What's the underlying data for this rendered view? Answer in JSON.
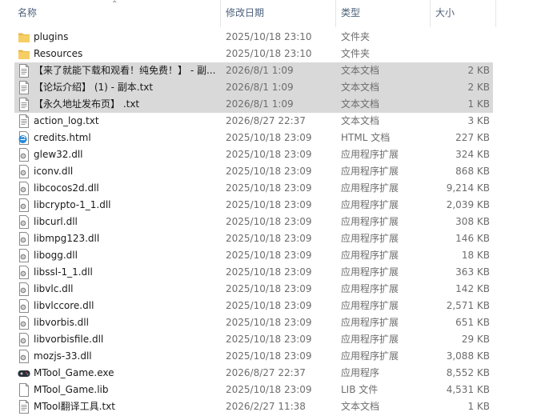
{
  "columns": {
    "name": "名称",
    "date": "修改日期",
    "type": "类型",
    "size": "大小"
  },
  "sort_indicator": "⌃",
  "files": [
    {
      "name": "plugins",
      "date": "2025/10/18 23:10",
      "type": "文件夹",
      "size": "",
      "icon": "folder-icon",
      "selected": false
    },
    {
      "name": "Resources",
      "date": "2025/10/18 23:10",
      "type": "文件夹",
      "size": "",
      "icon": "folder-icon",
      "selected": false
    },
    {
      "name": "【来了就能下载和观看！纯免费！】 - 副...",
      "date": "2026/8/1 1:09",
      "type": "文本文档",
      "size": "2 KB",
      "icon": "text-file-icon",
      "selected": true
    },
    {
      "name": "【论坛介绍】 (1) - 副本.txt",
      "date": "2026/8/1 1:09",
      "type": "文本文档",
      "size": "2 KB",
      "icon": "text-file-icon",
      "selected": true
    },
    {
      "name": "【永久地址发布页】 .txt",
      "date": "2026/8/1 1:09",
      "type": "文本文档",
      "size": "1 KB",
      "icon": "text-file-icon",
      "selected": true
    },
    {
      "name": "action_log.txt",
      "date": "2026/8/27 22:37",
      "type": "文本文档",
      "size": "3 KB",
      "icon": "text-file-icon",
      "selected": false
    },
    {
      "name": "credits.html",
      "date": "2025/10/18 23:09",
      "type": "HTML 文档",
      "size": "227 KB",
      "icon": "html-file-icon",
      "selected": false
    },
    {
      "name": "glew32.dll",
      "date": "2025/10/18 23:09",
      "type": "应用程序扩展",
      "size": "324 KB",
      "icon": "dll-file-icon",
      "selected": false
    },
    {
      "name": "iconv.dll",
      "date": "2025/10/18 23:09",
      "type": "应用程序扩展",
      "size": "868 KB",
      "icon": "dll-file-icon",
      "selected": false
    },
    {
      "name": "libcocos2d.dll",
      "date": "2025/10/18 23:09",
      "type": "应用程序扩展",
      "size": "9,214 KB",
      "icon": "dll-file-icon",
      "selected": false
    },
    {
      "name": "libcrypto-1_1.dll",
      "date": "2025/10/18 23:09",
      "type": "应用程序扩展",
      "size": "2,039 KB",
      "icon": "dll-file-icon",
      "selected": false
    },
    {
      "name": "libcurl.dll",
      "date": "2025/10/18 23:09",
      "type": "应用程序扩展",
      "size": "308 KB",
      "icon": "dll-file-icon",
      "selected": false
    },
    {
      "name": "libmpg123.dll",
      "date": "2025/10/18 23:09",
      "type": "应用程序扩展",
      "size": "146 KB",
      "icon": "dll-file-icon",
      "selected": false
    },
    {
      "name": "libogg.dll",
      "date": "2025/10/18 23:09",
      "type": "应用程序扩展",
      "size": "18 KB",
      "icon": "dll-file-icon",
      "selected": false
    },
    {
      "name": "libssl-1_1.dll",
      "date": "2025/10/18 23:09",
      "type": "应用程序扩展",
      "size": "363 KB",
      "icon": "dll-file-icon",
      "selected": false
    },
    {
      "name": "libvlc.dll",
      "date": "2025/10/18 23:09",
      "type": "应用程序扩展",
      "size": "142 KB",
      "icon": "dll-file-icon",
      "selected": false
    },
    {
      "name": "libvlccore.dll",
      "date": "2025/10/18 23:09",
      "type": "应用程序扩展",
      "size": "2,571 KB",
      "icon": "dll-file-icon",
      "selected": false
    },
    {
      "name": "libvorbis.dll",
      "date": "2025/10/18 23:09",
      "type": "应用程序扩展",
      "size": "651 KB",
      "icon": "dll-file-icon",
      "selected": false
    },
    {
      "name": "libvorbisfile.dll",
      "date": "2025/10/18 23:09",
      "type": "应用程序扩展",
      "size": "29 KB",
      "icon": "dll-file-icon",
      "selected": false
    },
    {
      "name": "mozjs-33.dll",
      "date": "2025/10/18 23:09",
      "type": "应用程序扩展",
      "size": "3,088 KB",
      "icon": "dll-file-icon",
      "selected": false
    },
    {
      "name": "MTool_Game.exe",
      "date": "2026/8/27 22:37",
      "type": "应用程序",
      "size": "8,552 KB",
      "icon": "gamepad-icon",
      "selected": false
    },
    {
      "name": "MTool_Game.lib",
      "date": "2025/10/18 23:09",
      "type": "LIB 文件",
      "size": "4,531 KB",
      "icon": "blank-file-icon",
      "selected": false
    },
    {
      "name": "MTool翻译工具.txt",
      "date": "2026/2/27 11:38",
      "type": "文本文档",
      "size": "1 KB",
      "icon": "text-file-icon",
      "selected": false
    }
  ]
}
